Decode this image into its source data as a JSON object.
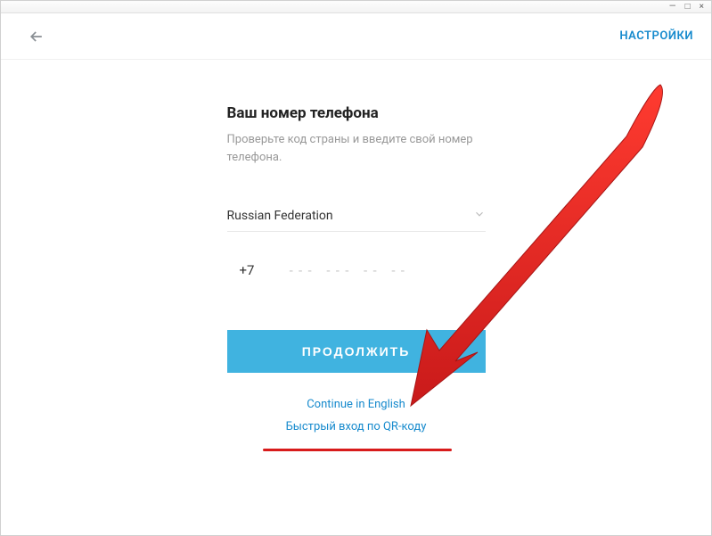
{
  "window": {
    "minimize": "—",
    "maximize": "□",
    "close": "×"
  },
  "header": {
    "settings_label": "НАСТРОЙКИ"
  },
  "form": {
    "title": "Ваш номер телефона",
    "subtitle": "Проверьте код страны и введите свой номер телефона.",
    "country": "Russian Federation",
    "dial_code": "+7",
    "phone_placeholder": "--- --- -- --",
    "continue_label": "ПРОДОЛЖИТЬ"
  },
  "links": {
    "english": "Continue in English",
    "qr": "Быстрый вход по QR-коду"
  }
}
